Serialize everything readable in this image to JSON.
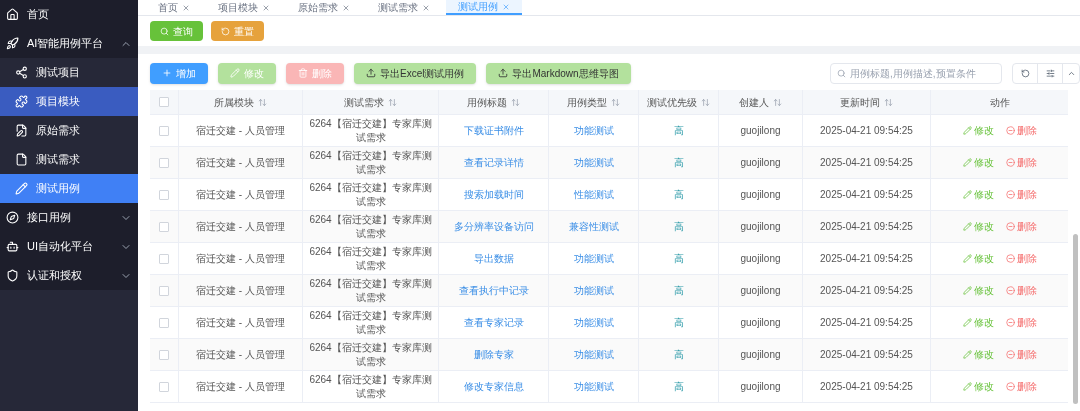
{
  "sidebar": {
    "items": [
      {
        "label": "首页",
        "selected": false
      },
      {
        "label": "AI智能用例平台",
        "expanded": true,
        "selected": false,
        "children": [
          {
            "label": "测试项目",
            "selected": false,
            "highlighted": false
          },
          {
            "label": "项目模块",
            "selected": false,
            "highlighted": true
          },
          {
            "label": "原始需求",
            "selected": false,
            "highlighted": false
          },
          {
            "label": "测试需求",
            "selected": false,
            "highlighted": false
          },
          {
            "label": "测试用例",
            "selected": true,
            "highlighted": false
          }
        ]
      },
      {
        "label": "接口用例",
        "expanded": false,
        "selected": false
      },
      {
        "label": "UI自动化平台",
        "expanded": false,
        "selected": false
      },
      {
        "label": "认证和授权",
        "expanded": false,
        "selected": false
      }
    ]
  },
  "tabs": [
    {
      "label": "首页",
      "selected": false
    },
    {
      "label": "项目模块",
      "selected": false
    },
    {
      "label": "原始需求",
      "selected": false
    },
    {
      "label": "测试需求",
      "selected": false
    },
    {
      "label": "测试用例",
      "selected": true
    }
  ],
  "filter_buttons": [
    {
      "label": "查询",
      "kind": "search"
    },
    {
      "label": "重置",
      "kind": "reset"
    }
  ],
  "toolbar": [
    {
      "label": "增加",
      "kind": "add",
      "disabled": false
    },
    {
      "label": "修改",
      "kind": "edit",
      "disabled": true
    },
    {
      "label": "删除",
      "kind": "delete",
      "disabled": true
    },
    {
      "label": "导出Excel测试用例",
      "kind": "export",
      "disabled": false
    },
    {
      "label": "导出Markdown思维导图",
      "kind": "export",
      "disabled": false
    }
  ],
  "search": {
    "placeholder": "用例标题,用例描述,预置条件"
  },
  "table": {
    "all_checked": false,
    "columns": [
      "所属模块",
      "测试需求",
      "用例标题",
      "用例类型",
      "测试优先级",
      "创建人",
      "更新时间",
      "动作"
    ],
    "rows": [
      {
        "checked": false,
        "module": "宿迁交建 - 人员管理",
        "requirement": "6264【宿迁交建】专家库测试需求",
        "title": "下载证书附件",
        "type": "功能测试",
        "priority": "高",
        "creator": "guojilong",
        "updated": "2025-04-21 09:54:25",
        "edit": "修改",
        "delete": "删除"
      },
      {
        "checked": false,
        "module": "宿迁交建 - 人员管理",
        "requirement": "6264【宿迁交建】专家库测试需求",
        "title": "查看记录详情",
        "type": "功能测试",
        "priority": "高",
        "creator": "guojilong",
        "updated": "2025-04-21 09:54:25",
        "edit": "修改",
        "delete": "删除"
      },
      {
        "checked": false,
        "module": "宿迁交建 - 人员管理",
        "requirement": "6264【宿迁交建】专家库测试需求",
        "title": "搜索加载时间",
        "type": "性能测试",
        "priority": "高",
        "creator": "guojilong",
        "updated": "2025-04-21 09:54:25",
        "edit": "修改",
        "delete": "删除"
      },
      {
        "checked": false,
        "module": "宿迁交建 - 人员管理",
        "requirement": "6264【宿迁交建】专家库测试需求",
        "title": "多分辨率设备访问",
        "type": "兼容性测试",
        "priority": "高",
        "creator": "guojilong",
        "updated": "2025-04-21 09:54:25",
        "edit": "修改",
        "delete": "删除"
      },
      {
        "checked": false,
        "module": "宿迁交建 - 人员管理",
        "requirement": "6264【宿迁交建】专家库测试需求",
        "title": "导出数据",
        "type": "功能测试",
        "priority": "高",
        "creator": "guojilong",
        "updated": "2025-04-21 09:54:25",
        "edit": "修改",
        "delete": "删除"
      },
      {
        "checked": false,
        "module": "宿迁交建 - 人员管理",
        "requirement": "6264【宿迁交建】专家库测试需求",
        "title": "查看执行中记录",
        "type": "功能测试",
        "priority": "高",
        "creator": "guojilong",
        "updated": "2025-04-21 09:54:25",
        "edit": "修改",
        "delete": "删除"
      },
      {
        "checked": false,
        "module": "宿迁交建 - 人员管理",
        "requirement": "6264【宿迁交建】专家库测试需求",
        "title": "查看专家记录",
        "type": "功能测试",
        "priority": "高",
        "creator": "guojilong",
        "updated": "2025-04-21 09:54:25",
        "edit": "修改",
        "delete": "删除"
      },
      {
        "checked": false,
        "module": "宿迁交建 - 人员管理",
        "requirement": "6264【宿迁交建】专家库测试需求",
        "title": "删除专家",
        "type": "功能测试",
        "priority": "高",
        "creator": "guojilong",
        "updated": "2025-04-21 09:54:25",
        "edit": "修改",
        "delete": "删除"
      },
      {
        "checked": false,
        "module": "宿迁交建 - 人员管理",
        "requirement": "6264【宿迁交建】专家库测试需求",
        "title": "修改专家信息",
        "type": "功能测试",
        "priority": "高",
        "creator": "guojilong",
        "updated": "2025-04-21 09:54:25",
        "edit": "修改",
        "delete": "删除"
      }
    ]
  }
}
